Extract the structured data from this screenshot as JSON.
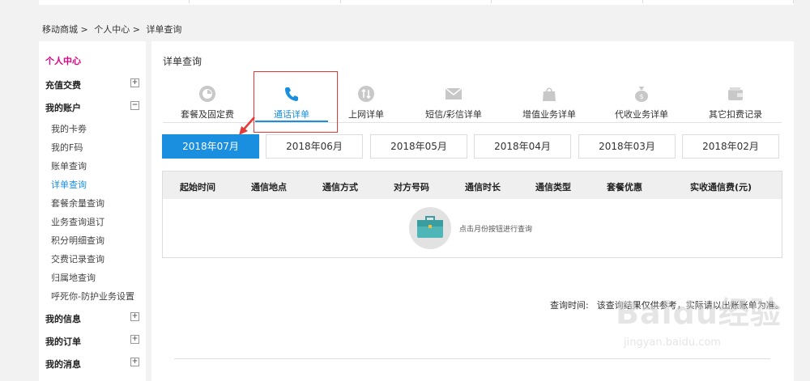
{
  "breadcrumb": [
    "移动商城 >",
    "个人中心 >",
    "详单查询"
  ],
  "sidebar": {
    "title": "个人中心",
    "groups": [
      {
        "label": "充值交费",
        "toggle": "+"
      },
      {
        "label": "我的账户",
        "toggle": "−"
      },
      {
        "label": "我的信息",
        "toggle": "+"
      },
      {
        "label": "我的订单",
        "toggle": "+"
      },
      {
        "label": "我的消息",
        "toggle": "+"
      }
    ],
    "account_items": [
      "我的卡劵",
      "我的F码",
      "账单查询",
      "详单查询",
      "套餐余量查询",
      "业务查询退订",
      "积分明细查询",
      "交费记录查询",
      "归属地查询",
      "呼死你-防护业务设置"
    ],
    "active_item": "详单查询"
  },
  "main": {
    "title": "详单查询",
    "categories": [
      {
        "label": "套餐及固定费",
        "icon": "pie-clock-icon"
      },
      {
        "label": "通话详单",
        "icon": "phone-icon",
        "active": true
      },
      {
        "label": "上网详单",
        "icon": "data-arrows-icon"
      },
      {
        "label": "短信/彩信详单",
        "icon": "envelope-icon"
      },
      {
        "label": "增值业务详单",
        "icon": "shopping-bag-icon"
      },
      {
        "label": "代收业务详单",
        "icon": "money-bag-icon"
      },
      {
        "label": "其它扣费记录",
        "icon": "wallet-icon"
      }
    ],
    "months": [
      "2018年07月",
      "2018年06月",
      "2018年05月",
      "2018年04月",
      "2018年03月",
      "2018年02月"
    ],
    "active_month": "2018年07月",
    "table_headers": [
      "起始时间",
      "通信地点",
      "通信方式",
      "对方号码",
      "通信时长",
      "通信类型",
      "套餐优惠",
      "实收通信费(元)"
    ],
    "empty_text": "点击月份按钮进行查询",
    "query_note_label": "查询时间:",
    "query_note_text": "该查询结果仅供参考，实际请以出账账单为准。"
  },
  "colors": {
    "accent": "#1a8fe0",
    "brand_pink": "#e4007f",
    "highlight": "#e53935"
  },
  "watermark": {
    "logo": "Baidu经验",
    "url": "jingyan.baidu.com"
  }
}
